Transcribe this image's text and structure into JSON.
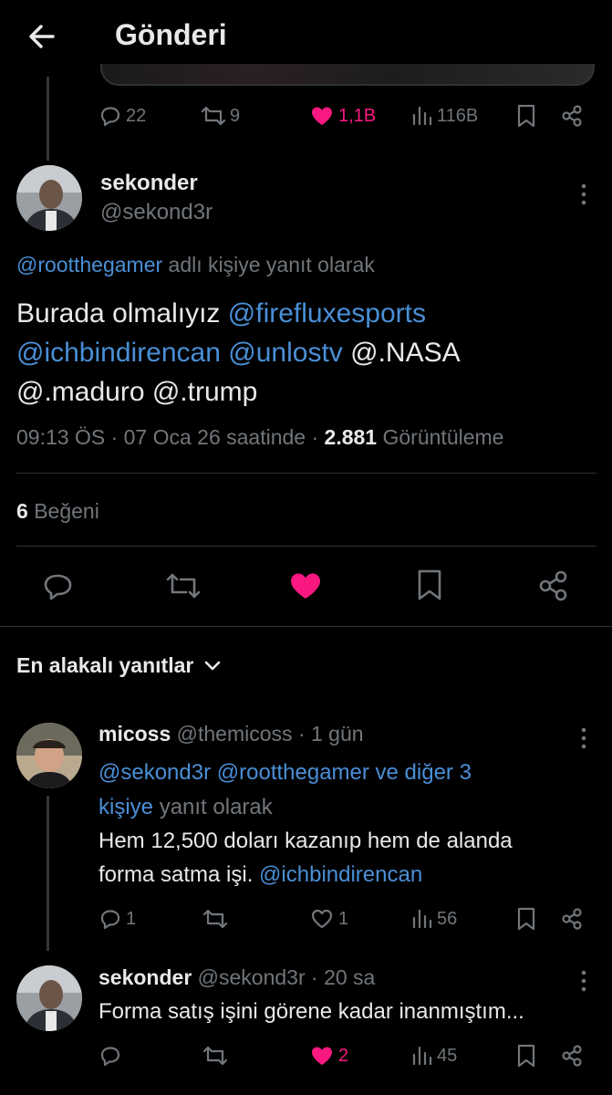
{
  "header": {
    "title": "Gönderi"
  },
  "parent_actions": {
    "replies": "22",
    "reposts": "9",
    "likes": "1,1B",
    "views": "116B"
  },
  "tweet": {
    "name": "sekonder",
    "handle": "@sekond3r",
    "replying_mention": "@rootthegamer",
    "replying_suffix": "adlı kişiye yanıt olarak",
    "text_plain_1": "Burada olmalıyız",
    "mention_1": "@firefluxesports",
    "mention_2": "@ichbindirencan",
    "mention_3": "@unlostv",
    "text_plain_2": "@.NASA",
    "text_plain_3": "@.maduro @.trump",
    "time": "09:13 ÖS · 07 Oca 26 saatinde ·",
    "views": "2.881",
    "views_label": "Görüntüleme",
    "likes_count": "6",
    "likes_label": "Beğeni"
  },
  "sort": {
    "label": "En alakalı yanıtlar"
  },
  "replies": [
    {
      "name": "micoss",
      "handle": "@themicoss",
      "time": "· 1 gün",
      "replying_mentions": "@sekond3r @rootthegamer ve diğer 3",
      "replying_mentions_2": "kişiye",
      "replying_suffix": "yanıt olarak",
      "text_line_1": "Hem 12,500 doları kazanıp hem de alanda",
      "text_line_2": "forma satma işi.",
      "text_mention": "@ichbindirencan",
      "replies": "1",
      "likes": "1",
      "views": "56"
    },
    {
      "name": "sekonder",
      "handle": "@sekond3r",
      "time": "· 20 sa",
      "text_line_1": "Forma satış işini görene kadar inanmıştım...",
      "likes": "2",
      "views": "45"
    }
  ],
  "colors": {
    "accent": "#4a8fd6",
    "like": "#f91880",
    "muted": "#71767b",
    "divider": "#2f3336"
  }
}
